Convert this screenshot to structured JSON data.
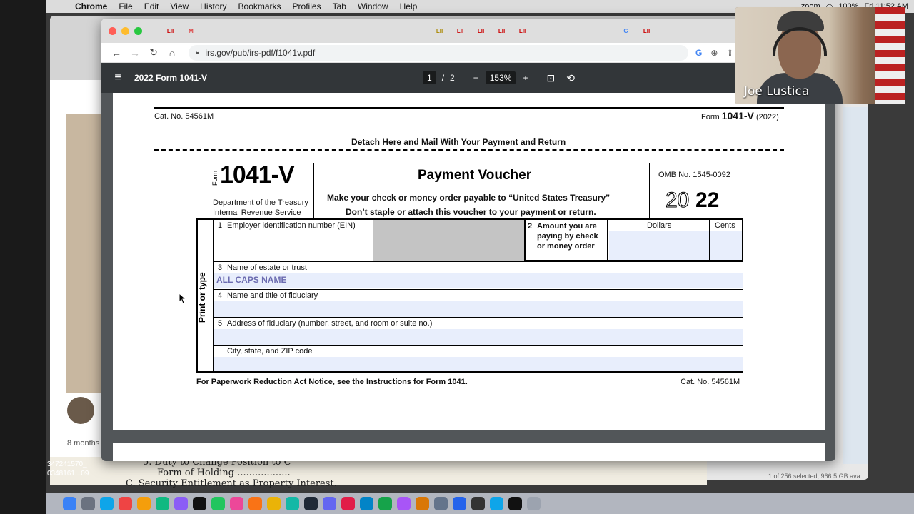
{
  "menubar": {
    "app": "Chrome",
    "items": [
      "File",
      "Edit",
      "View",
      "History",
      "Bookmarks",
      "Profiles",
      "Tab",
      "Window",
      "Help"
    ],
    "zoom_label": "zoom",
    "battery": "100%",
    "clock": "Fri 11:52 AM"
  },
  "browser": {
    "tab_labels": [
      "LII",
      "M",
      "",
      "",
      "",
      "",
      "",
      "",
      "",
      "",
      "",
      "",
      "",
      "LII",
      "LII",
      "LII",
      "LII",
      "LII",
      "",
      "",
      "",
      "",
      "G",
      "LII",
      "",
      "",
      ""
    ],
    "url": "irs.gov/pub/irs-pdf/f1041v.pdf"
  },
  "pdf_viewer": {
    "title": "2022 Form 1041-V",
    "current_page": "1",
    "page_sep": "/",
    "total_pages": "2",
    "zoom": "153%",
    "zoom_out": "−",
    "zoom_in": "+"
  },
  "form": {
    "cat_top": "Cat. No. 54561M",
    "form_top_prefix": "Form",
    "form_top_num": "1041-V",
    "form_top_year": "(2022)",
    "detach": "Detach Here and Mail With Your Payment and Return",
    "form_word": "Form",
    "form_number": "1041-V",
    "dept1": "Department of the Treasury",
    "dept2": "Internal Revenue Service",
    "heading": "Payment Voucher",
    "instr1": "Make your check or money order payable to “United States Treasury”",
    "instr2": "Don’t staple or attach this voucher to your payment or return.",
    "omb": "OMB No. 1545-0092",
    "year_light": "20",
    "year_bold": "22",
    "print_or_type": "Print or type",
    "line1_num": "1",
    "line1_label": "Employer identification number (EIN)",
    "line2_num": "2",
    "line2_label_a": "Amount you are",
    "line2_label_b": "paying by check",
    "line2_label_c": "or money order",
    "dollars": "Dollars",
    "cents": "Cents",
    "line3_num": "3",
    "line3_label": "Name of estate or trust",
    "line3_value": "ALL CAPS NAME",
    "line4_num": "4",
    "line4_label": "Name and title of fiduciary",
    "line5_num": "5",
    "line5_label": "Address of fiduciary (number, street, and room or suite no.)",
    "city_label": "City, state, and ZIP code",
    "footer_left": "For Paperwork Reduction Act Notice, see the Instructions for Form 1041.",
    "footer_right": "Cat. No. 54561M"
  },
  "webcam": {
    "name": "Joe Lustica"
  },
  "background": {
    "time_ago": "8 months",
    "ids_line1": "347241570_",
    "ids_line2": "0348161...09",
    "content_line1": "5. Duty to Change Position to C",
    "content_line2": "Form of Holding ..................",
    "content_line3": "C.  Security Entitlement as Property Interest.",
    "status": "1 of 256 selected, 966.5 GB ava"
  },
  "colors": {
    "pdf_toolbar": "#323639",
    "viewer_bg": "#525659",
    "field_fill": "#e8eefc",
    "filled_text": "#6b6bb0",
    "ein_shade": "#c4c4c4"
  }
}
